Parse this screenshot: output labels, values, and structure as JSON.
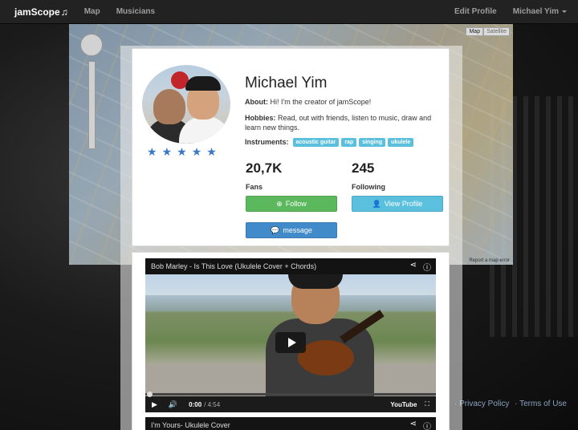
{
  "navbar": {
    "brand": "jamScope",
    "brand_icon": "music-note-icon",
    "links": [
      "Map",
      "Musicians"
    ],
    "edit_profile": "Edit Profile",
    "user_menu": "Michael Yim"
  },
  "map": {
    "type_map": "Map",
    "type_satellite": "Satellite",
    "report": "Report a map error"
  },
  "footer": {
    "links": [
      "· Privacy Policy",
      "· Terms of Use"
    ]
  },
  "profile": {
    "name": "Michael Yim",
    "about_label": "About:",
    "about_text": "Hi! I'm the creator of jamScope!",
    "hobbies_label": "Hobbies:",
    "hobbies_text": "Read, out with friends, listen to music, draw and learn new things.",
    "instruments_label": "Instruments:",
    "instruments": [
      "acoustic guitar",
      "rap",
      "singing",
      "ukulele"
    ],
    "rating": 5,
    "fans_count": "20,7K",
    "fans_label": "Fans",
    "following_count": "245",
    "following_label": "Following",
    "follow_button": "Follow",
    "view_profile_button": "View Profile",
    "message_button": "message"
  },
  "videos": [
    {
      "title": "Bob Marley - Is This Love (Ukulele Cover + Chords)",
      "current_time": "0:00",
      "duration": "/ 4:54",
      "brand": "YouTube"
    },
    {
      "title": "I'm Yours- Ukulele Cover"
    }
  ],
  "colors": {
    "follow": "#5cb85c",
    "view_profile": "#5bc0de",
    "message": "#428bca",
    "star": "#3a79c6",
    "navbar": "#222222"
  }
}
